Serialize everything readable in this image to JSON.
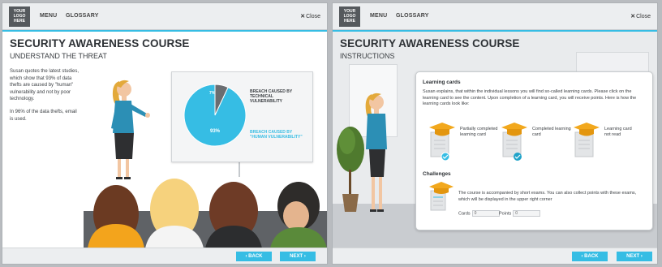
{
  "colors": {
    "accent": "#36bde4",
    "pie_dark": "#6a6d71",
    "hat": "#f2a81d"
  },
  "left_screen": {
    "logo": "YOUR\nLOGO\nHERE",
    "menu": "MENU",
    "glossary": "GLOSSARY",
    "close": "Close",
    "title": "SECURITY AWARENESS COURSE",
    "subtitle": "UNDERSTAND THE THREAT",
    "paragraph1": "Susan quotes the latest studies, which show that 93% of data thefts are caused by \"human\" vulnerability and not by poor technology.",
    "paragraph2": "In 96% of the data thefts, email is used.",
    "chart_data": {
      "type": "pie",
      "slices": [
        {
          "label": "BREACH CAUSED BY TECHNICAL VULNERABILITY",
          "value": 7,
          "display": "7%",
          "color": "#6a6d71"
        },
        {
          "label": "BREACH CAUSED BY \"HUMAN VULNERABILITY\"",
          "value": 93,
          "display": "93%",
          "color": "#36bde4"
        }
      ]
    },
    "back": "BACK",
    "next": "NEXT"
  },
  "right_screen": {
    "logo": "YOUR\nLOGO\nHERE",
    "menu": "MENU",
    "glossary": "GLOSSARY",
    "close": "Close",
    "title": "SECURITY AWARENESS COURSE",
    "subtitle": "INSTRUCTIONS",
    "learning_cards_heading": "Learning cards",
    "learning_cards_text": "Susan explains, that within the individual lessons you will find so-called learning cards. Please click on the learning card to see the content. Upon completion of a learning card, you will receive points. Here is how the learning cards look like:",
    "cards": [
      {
        "label": "Partially completed learning card",
        "icon": "partial-check-icon"
      },
      {
        "label": "Completed learning card",
        "icon": "check-icon"
      },
      {
        "label": "Learning card not read",
        "icon": "none"
      }
    ],
    "challenges_heading": "Challenges",
    "challenges_text": "The course is accompanied by short exams. You can also collect points with these exams, which will be displayed in the upper right corner",
    "cards_label": "Cards",
    "cards_value": "0",
    "points_label": "Points",
    "points_value": "0",
    "back": "BACK",
    "next": "NEXT"
  }
}
